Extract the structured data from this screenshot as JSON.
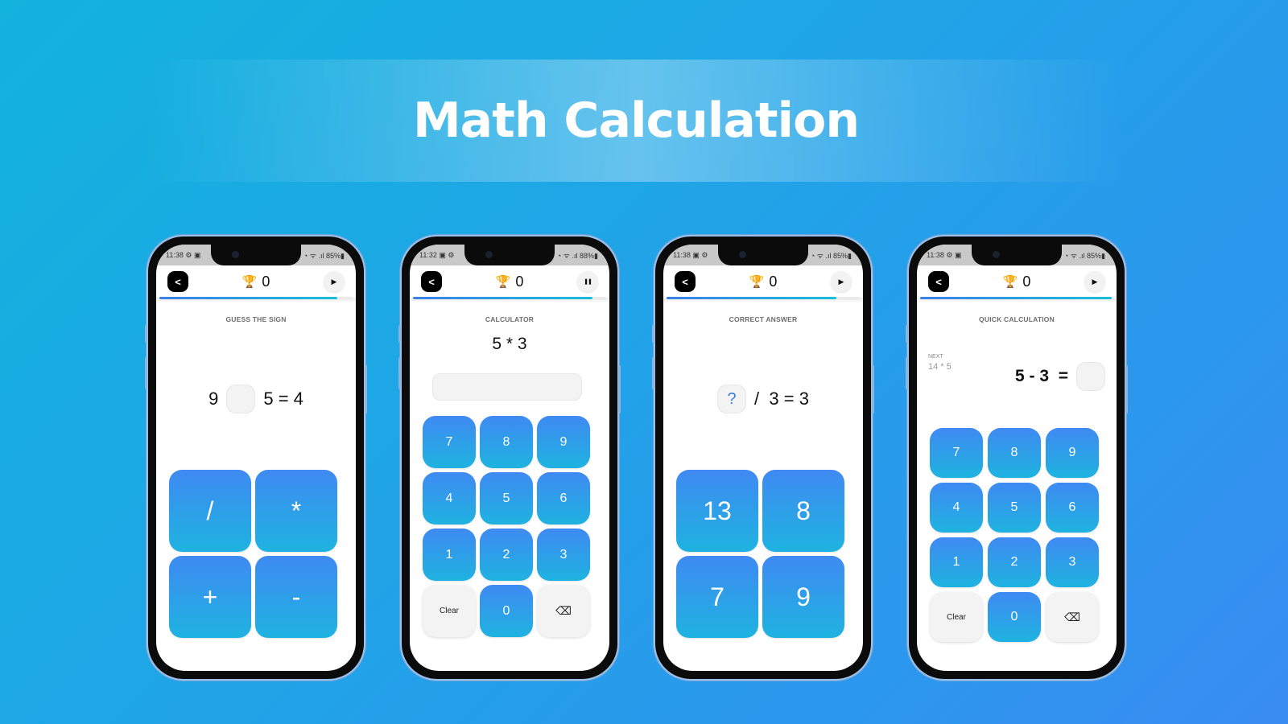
{
  "banner": {
    "title": "Math Calculation"
  },
  "colors": {
    "key_gradient_top": "#3f8af2",
    "key_gradient_bottom": "#1eb3e0",
    "trophy": "#f5c518",
    "background": "#1ea6e6"
  },
  "phones": [
    {
      "status": {
        "time": "11:38",
        "icons_left": "⚙ ▣",
        "icons_right": "◔ ᯤ .ıl 85%▮"
      },
      "score": "0",
      "control_icon": "play-icon",
      "control_glyph": "▶",
      "progress": 0.92,
      "mode_title": "GUESS THE SIGN",
      "equation": {
        "left": "9",
        "right": "5 = 4",
        "slot": ""
      },
      "keys": [
        "/",
        "*",
        "+",
        "-"
      ]
    },
    {
      "status": {
        "time": "11:32",
        "icons_left": "▣ ⚙",
        "icons_right": "◔ ᯤ .ıl 88%▮"
      },
      "score": "0",
      "control_icon": "pause-icon",
      "control_glyph": "❚❚",
      "progress": 0.93,
      "mode_title": "CALCULATOR",
      "question": "5 * 3",
      "input_value": "",
      "keys": [
        "7",
        "8",
        "9",
        "4",
        "5",
        "6",
        "1",
        "2",
        "3"
      ],
      "clear_label": "Clear",
      "zero_label": "0",
      "backspace_glyph": "⌫"
    },
    {
      "status": {
        "time": "11:38",
        "icons_left": "▣ ⚙",
        "icons_right": "◔ ᯤ .ıl 85%▮"
      },
      "score": "0",
      "control_icon": "play-icon",
      "control_glyph": "▶",
      "progress": 0.88,
      "mode_title": "CORRECT ANSWER",
      "equation": {
        "slot": "?",
        "right": "/  3 = 3"
      },
      "keys": [
        "13",
        "8",
        "7",
        "9"
      ]
    },
    {
      "status": {
        "time": "11:38",
        "icons_left": "⚙ ▣",
        "icons_right": "◔ ᯤ .ıl 85%▮"
      },
      "score": "0",
      "control_icon": "play-icon",
      "control_glyph": "▶",
      "progress": 0.99,
      "mode_title": "QUICK CALCULATION",
      "next_label": "NEXT",
      "next_value": "14 * 5",
      "equation": {
        "left": "5 - 3  =",
        "slot": ""
      },
      "keys": [
        "7",
        "8",
        "9",
        "4",
        "5",
        "6",
        "1",
        "2",
        "3"
      ],
      "clear_label": "Clear",
      "zero_label": "0",
      "backspace_glyph": "⌫"
    }
  ]
}
